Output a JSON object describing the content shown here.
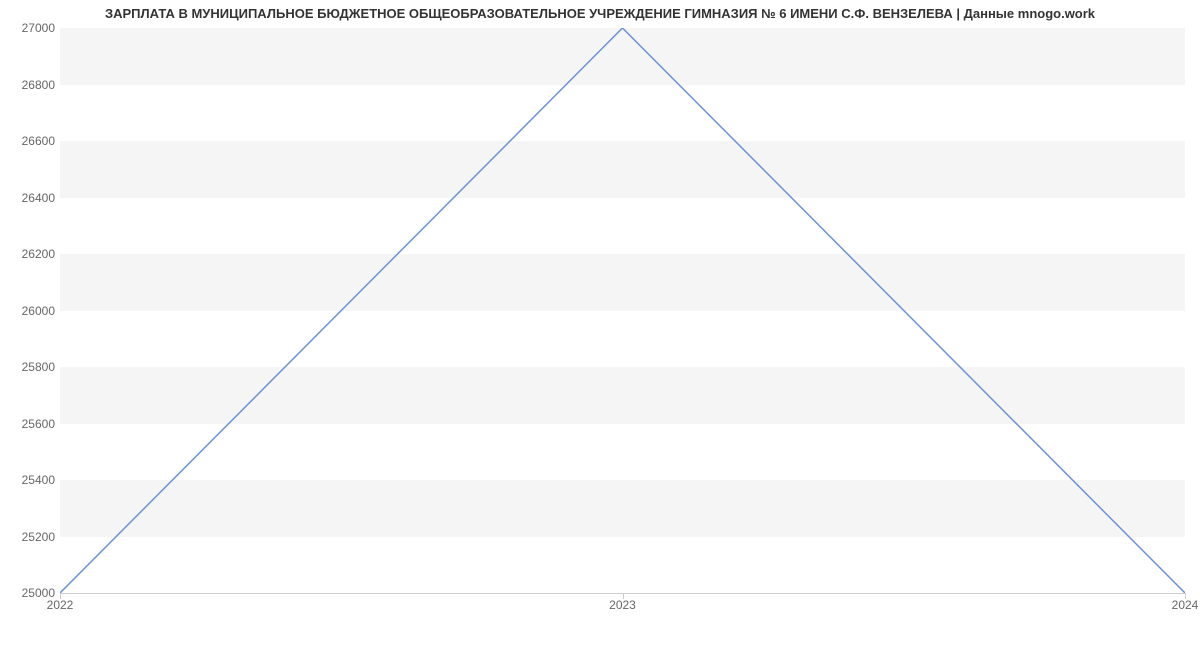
{
  "chart_data": {
    "type": "line",
    "title": "ЗАРПЛАТА В МУНИЦИПАЛЬНОЕ БЮДЖЕТНОЕ ОБЩЕОБРАЗОВАТЕЛЬНОЕ УЧРЕЖДЕНИЕ ГИМНАЗИЯ № 6 ИМЕНИ С.Ф. ВЕНЗЕЛЕВА | Данные mnogo.work",
    "x": [
      2022,
      2023,
      2024
    ],
    "values": [
      25000,
      27000,
      25000
    ],
    "xlabel": "",
    "ylabel": "",
    "x_ticks": [
      2022,
      2023,
      2024
    ],
    "y_ticks": [
      25000,
      25200,
      25400,
      25600,
      25800,
      26000,
      26200,
      26400,
      26600,
      26800,
      27000
    ],
    "xlim": [
      2022,
      2024
    ],
    "ylim": [
      25000,
      27000
    ],
    "line_color": "#6b93d6"
  }
}
